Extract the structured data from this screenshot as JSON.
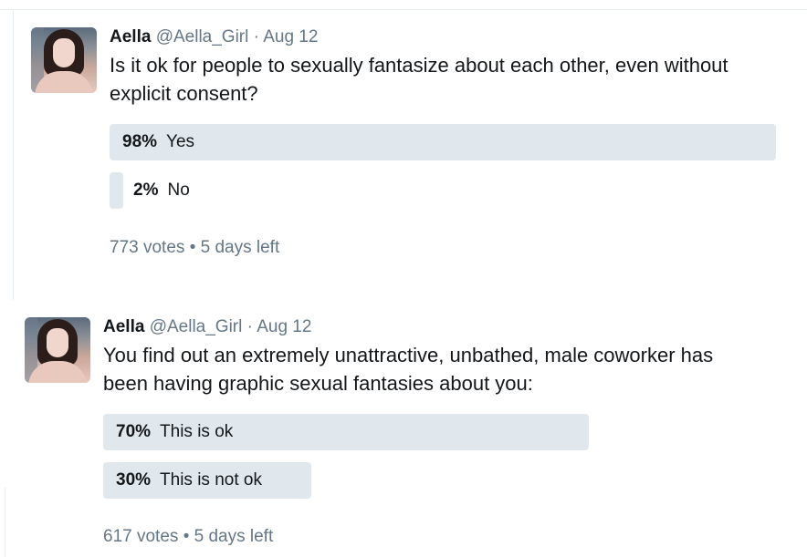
{
  "tweets": [
    {
      "name": "Aella",
      "handle": "@Aella_Girl",
      "separator": " · ",
      "date": "Aug 12",
      "text_line1": "Is it ok for people to sexually fantasize about each other, even without",
      "text_line2": "explicit consent?",
      "choices": [
        {
          "percent": "98%",
          "label": "Yes",
          "value": 0.98
        },
        {
          "percent": "2%",
          "label": "No",
          "value": 0.02
        }
      ],
      "votes": "773 votes",
      "dot": "•",
      "time_left": "5 days left"
    },
    {
      "name": "Aella",
      "handle": "@Aella_Girl",
      "separator": " · ",
      "date": "Aug 12",
      "text_line1": "You find out an extremely unattractive, unbathed, male coworker has",
      "text_line2": "been having graphic sexual fantasies about you:",
      "choices": [
        {
          "percent": "70%",
          "label": "This is ok",
          "value": 0.7
        },
        {
          "percent": "30%",
          "label": "This is not ok",
          "value": 0.3
        }
      ],
      "votes": "617 votes",
      "dot": "•",
      "time_left": "5 days left"
    }
  ]
}
